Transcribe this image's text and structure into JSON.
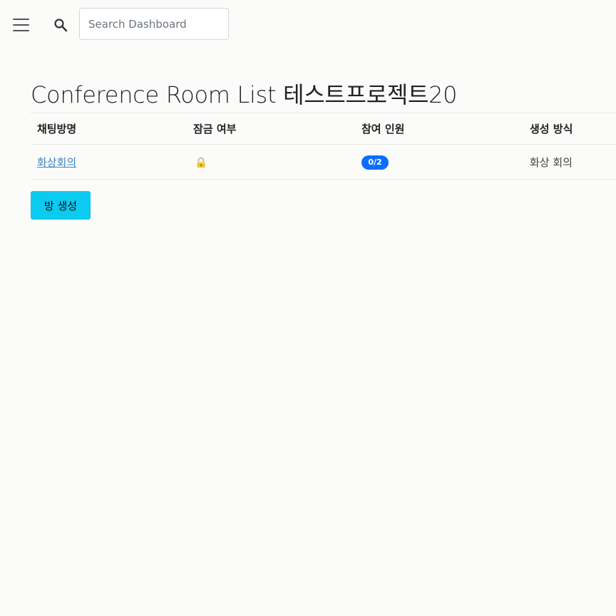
{
  "header": {
    "menu_icon": "hamburger-menu-icon",
    "search_icon": "search-icon",
    "search": {
      "placeholder": "Search Dashboard",
      "value": ""
    }
  },
  "page": {
    "title": "Conference Room List 테스트프로젝트20"
  },
  "table": {
    "columns": [
      "채팅방명",
      "잠금 여부",
      "참여 인원",
      "생성 방식"
    ],
    "rows": [
      {
        "name": "화상회의",
        "locked": true,
        "lock_icon": "lock-icon",
        "participants": "0/2",
        "creation_type": "화상 회의"
      }
    ]
  },
  "actions": {
    "create_room_label": "방 생성"
  },
  "colors": {
    "badge": "#0d6efd",
    "create_button": "#0dcaf0",
    "link": "#3e86c6"
  }
}
